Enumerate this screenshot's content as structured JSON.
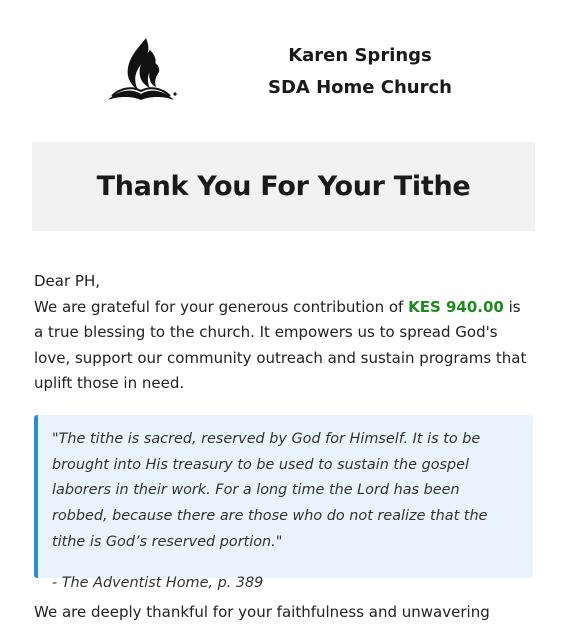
{
  "header": {
    "logo": "adventist-flame-bible-logo",
    "church_line1": "Karen Springs",
    "church_line2": "SDA Home Church"
  },
  "banner": {
    "title": "Thank You For Your Tithe"
  },
  "message": {
    "greeting": "Dear PH,",
    "intro_before": "We are grateful for your generous contribution of ",
    "amount": "KES 940.00",
    "intro_after": " is a true blessing to the church. It empowers us to spread God's love, support our community outreach and sustain programs that uplift those in need."
  },
  "quote": {
    "text": "\"The tithe is sacred, reserved by God for Himself. It is to be brought into His treasury to be used to sustain the gospel laborers in their work. For a long time the Lord has been robbed, because there are those who do not realize that the tithe is God’s reserved portion.\"",
    "source": "- The Adventist Home, p. 389"
  },
  "closing": {
    "text": "We are deeply thankful for your faithfulness and unwavering"
  },
  "colors": {
    "amount": "#1e8a1e",
    "quote_border": "#2f8ad8",
    "quote_background": "#e9f3fd",
    "banner_background": "#f2f2f2"
  }
}
